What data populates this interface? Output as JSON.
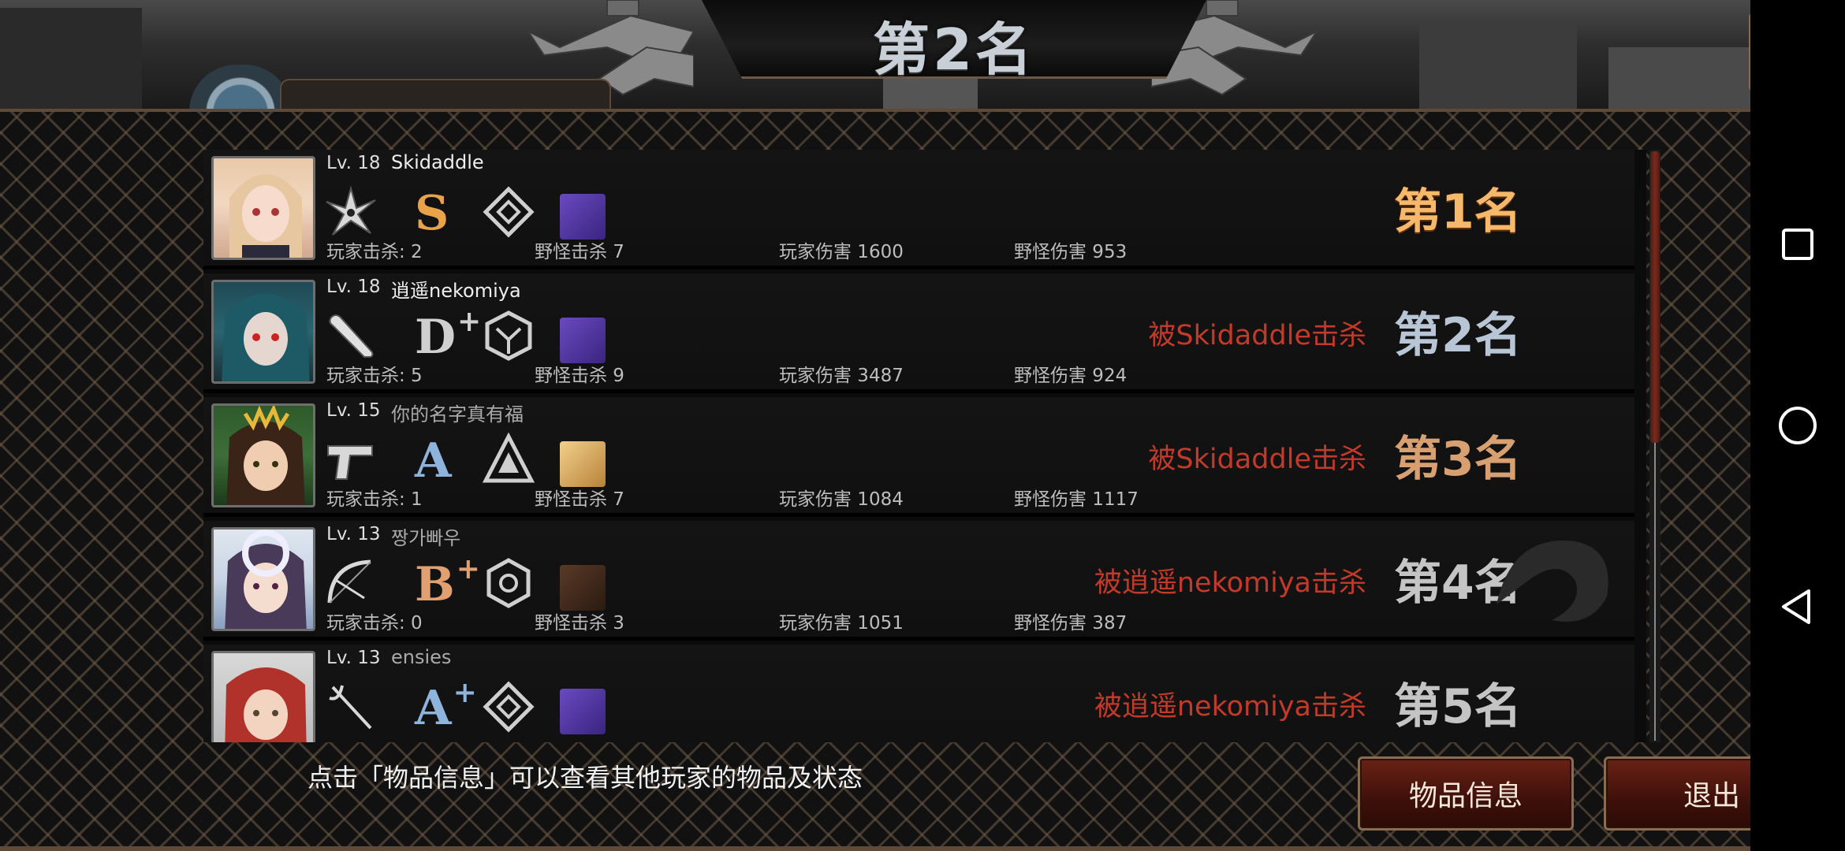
{
  "header": {
    "title": "第2名",
    "partial_player_name": "逍遥nekomiya"
  },
  "share_button": {
    "icon": "share-icon"
  },
  "players": [
    {
      "level": "Lv. 18",
      "name": "Skidaddle",
      "weapon_icon": "shuriken-icon",
      "grade": "S",
      "grade_plus": "",
      "grade_color": "#e8a24a",
      "emblem_icon": "diamond-emblem-icon",
      "item_icon": "purple-beast-icon",
      "player_kills": "玩家击杀: 2",
      "monster_kills": "野怪击杀 7",
      "player_damage": "玩家伤害 1600",
      "monster_damage": "野怪伤害 953",
      "killed_by": "",
      "rank": "第1名",
      "rank_style": "gold"
    },
    {
      "level": "Lv. 18",
      "name": "逍遥nekomiya",
      "weapon_icon": "bat-icon",
      "grade": "D",
      "grade_plus": "+",
      "grade_color": "#cfcfcf",
      "emblem_icon": "cube-emblem-icon",
      "item_icon": "purple-beast-icon",
      "player_kills": "玩家击杀: 5",
      "monster_kills": "野怪击杀 9",
      "player_damage": "玩家伤害 3487",
      "monster_damage": "野怪伤害 924",
      "killed_by": "被Skidaddle击杀",
      "rank": "第2名",
      "rank_style": "blue"
    },
    {
      "level": "Lv. 15",
      "name": "你的名字真有福",
      "weapon_icon": "pistol-icon",
      "grade": "A",
      "grade_plus": "",
      "grade_color": "#8fb4dc",
      "emblem_icon": "triangle-emblem-icon",
      "item_icon": "gold-item-icon",
      "player_kills": "玩家击杀: 1",
      "monster_kills": "野怪击杀 7",
      "player_damage": "玩家伤害 1084",
      "monster_damage": "野怪伤害 1117",
      "killed_by": "被Skidaddle击杀",
      "rank": "第3名",
      "rank_style": "bronze"
    },
    {
      "level": "Lv. 13",
      "name": "짱가빠우",
      "weapon_icon": "bow-icon",
      "grade": "B",
      "grade_plus": "+",
      "grade_color": "#e0a070",
      "emblem_icon": "hexagon-emblem-icon",
      "item_icon": "crossed-swords-icon",
      "player_kills": "玩家击杀: 0",
      "monster_kills": "野怪击杀 3",
      "player_damage": "玩家伤害 1051",
      "monster_damage": "野怪伤害 387",
      "killed_by": "被逍遥nekomiya击杀",
      "rank": "第4名",
      "rank_style": "gray"
    },
    {
      "level": "Lv. 13",
      "name": "ensies",
      "weapon_icon": "rapier-icon",
      "grade": "A",
      "grade_plus": "+",
      "grade_color": "#8fb4dc",
      "emblem_icon": "diamond-emblem-icon",
      "item_icon": "purple-beast-icon",
      "player_kills": "",
      "monster_kills": "",
      "player_damage": "",
      "monster_damage": "",
      "killed_by": "被逍遥nekomiya击杀",
      "rank": "第5名",
      "rank_style": "gray"
    }
  ],
  "footer": {
    "hint": "点击「物品信息」可以查看其他玩家的物品及状态",
    "item_info_button": "物品信息",
    "exit_button": "退出"
  },
  "nav": {
    "recents": "recents-icon",
    "home": "home-icon",
    "back": "back-icon"
  }
}
